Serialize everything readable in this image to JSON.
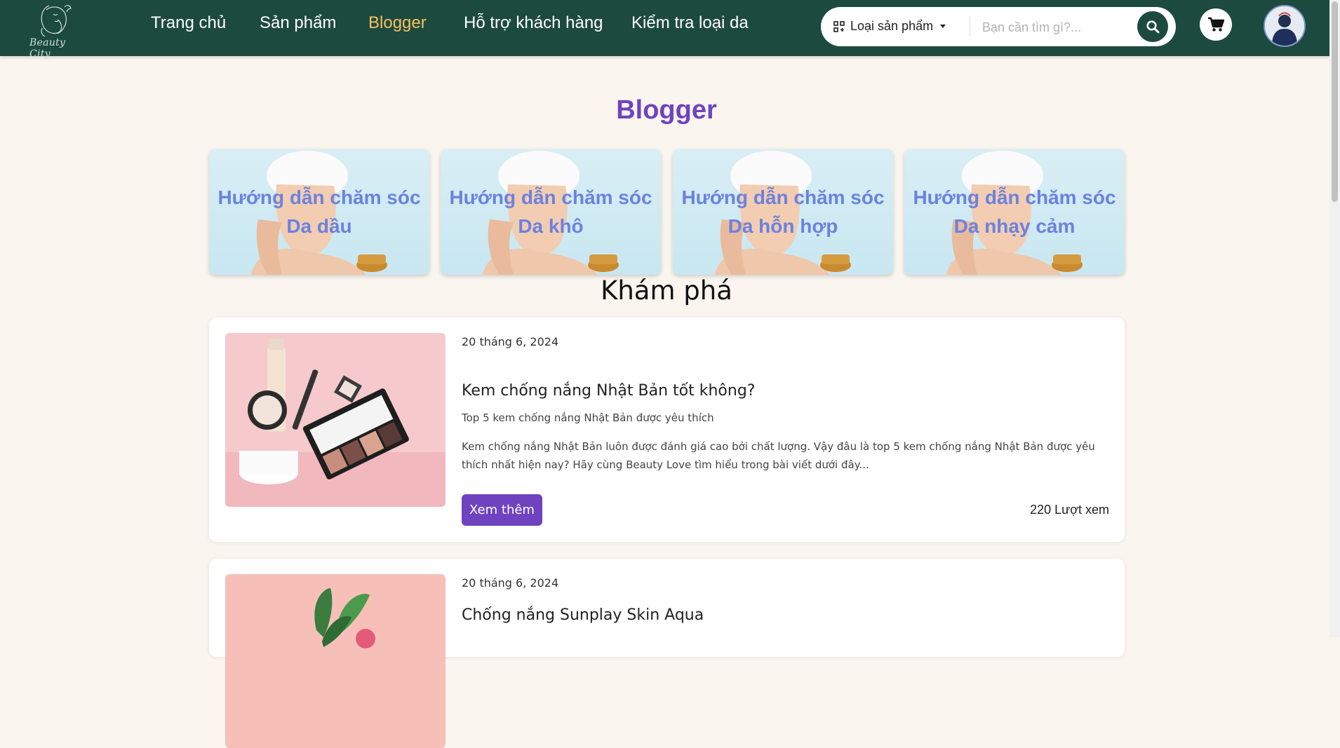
{
  "header": {
    "logo_text": "Beauty City",
    "nav": [
      {
        "label": "Trang chủ",
        "active": false
      },
      {
        "label": "Sản phẩm",
        "active": false
      },
      {
        "label": "Blogger",
        "active": true
      },
      {
        "label": "Hỗ trợ khách hàng",
        "active": false
      },
      {
        "label": "Kiểm tra loại da",
        "active": false
      }
    ],
    "search": {
      "category_label": "Loại sản phẩm",
      "placeholder": "Bạn cần tìm gì?...",
      "value": ""
    },
    "icons": {
      "category": "grid-icon",
      "search": "search-icon",
      "cart": "cart-icon",
      "avatar": "user-avatar"
    }
  },
  "page": {
    "title": "Blogger",
    "category_cards": [
      {
        "line1": "Hướng dẫn chăm sóc",
        "line2": "Da dầu"
      },
      {
        "line1": "Hướng dẫn chăm sóc",
        "line2": "Da khô"
      },
      {
        "line1": "Hướng dẫn chăm sóc",
        "line2": "Da hỗn hợp"
      },
      {
        "line1": "Hướng dẫn chăm sóc",
        "line2": "Da nhạy cảm"
      }
    ],
    "explore_heading": "Khám phá",
    "posts": [
      {
        "date": "20 tháng 6, 2024",
        "title": "Kem chống nắng Nhật Bản tốt không?",
        "subtitle": "Top 5 kem chống nắng Nhật Bản được yêu thích",
        "excerpt": "Kem chống nắng Nhật Bản luôn được đánh giá cao bởi chất lượng. Vậy đâu là top 5 kem chống nắng Nhật Bản được yêu thích nhất hiện nay? Hãy cùng Beauty Love tìm hiểu trong bài viết dưới đây...",
        "button": "Xem thêm",
        "views": "220 Lượt xem"
      },
      {
        "date": "20 tháng 6, 2024",
        "title": "Chống nắng Sunplay Skin Aqua"
      }
    ]
  },
  "colors": {
    "header_bg": "#1d4a3f",
    "nav_active": "#f6c15b",
    "accent_purple": "#6f43c0",
    "card_title": "#6b82df",
    "page_bg": "#faf5ee"
  }
}
